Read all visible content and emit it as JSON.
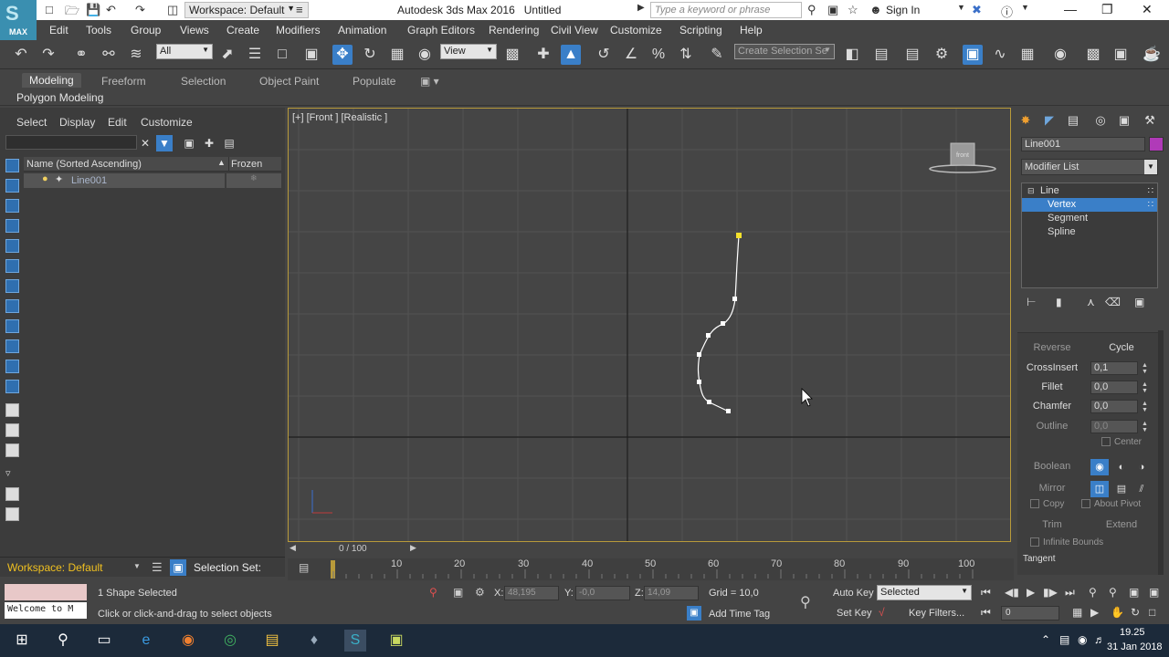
{
  "titlebar": {
    "app_logo": "MAX",
    "workspace": "Workspace: Default",
    "app_title": "Autodesk 3ds Max 2016",
    "file_title": "Untitled",
    "search_placeholder": "Type a keyword or phrase",
    "sign_in": "Sign In"
  },
  "menus": [
    "Edit",
    "Tools",
    "Group",
    "Views",
    "Create",
    "Modifiers",
    "Animation",
    "Graph Editors",
    "Rendering",
    "Civil View",
    "Customize",
    "Scripting",
    "Help"
  ],
  "toolbar": {
    "selection_filter": "All",
    "ref_coord": "View",
    "named_selection": "Create Selection Se"
  },
  "ribbon": {
    "tabs": [
      "Modeling",
      "Freeform",
      "Selection",
      "Object Paint",
      "Populate"
    ],
    "active_tab": "Modeling",
    "sub_label": "Polygon Modeling"
  },
  "explorer": {
    "menus": [
      "Select",
      "Display",
      "Edit",
      "Customize"
    ],
    "col_name": "Name (Sorted Ascending)",
    "col_frozen": "Frozen",
    "rows": [
      {
        "name": "Line001"
      }
    ]
  },
  "viewport": {
    "label": "[+] [Front ] [Realistic ]",
    "viewcube_face": "front"
  },
  "command_panel": {
    "object_name": "Line001",
    "object_color": "#b03ab8",
    "modifier_list": "Modifier List",
    "stack": [
      "Line",
      "Vertex",
      "Segment",
      "Spline"
    ],
    "selected_sub": "Vertex",
    "rollout": {
      "reverse": "Reverse",
      "cycle": "Cycle",
      "cross_insert": "CrossInsert",
      "cross_insert_val": "0,1",
      "fillet": "Fillet",
      "fillet_val": "0,0",
      "chamfer": "Chamfer",
      "chamfer_val": "0,0",
      "outline": "Outline",
      "outline_val": "0,0",
      "center": "Center",
      "boolean": "Boolean",
      "mirror": "Mirror",
      "copy": "Copy",
      "about_pivot": "About Pivot",
      "trim": "Trim",
      "extend": "Extend",
      "infinite_bounds": "Infinite Bounds",
      "tangent": "Tangent"
    }
  },
  "bottom": {
    "workspace": "Workspace: Default",
    "selection_set": "Selection Set:",
    "time_slider": "0 / 100",
    "ticks": [
      "10",
      "20",
      "30",
      "40",
      "50",
      "60",
      "70",
      "80",
      "90",
      "100"
    ],
    "listener": "Welcome to M",
    "status_selected": "1 Shape Selected",
    "status_prompt": "Click or click-and-drag to select objects",
    "x_label": "X:",
    "x_val": "48,195",
    "y_label": "Y:",
    "y_val": "-0,0",
    "z_label": "Z:",
    "z_val": "14,09",
    "grid": "Grid = 10,0",
    "add_time_tag": "Add Time Tag",
    "auto_key": "Auto Key",
    "set_key": "Set Key",
    "key_mode": "Selected",
    "key_filters": "Key Filters...",
    "frame": "0"
  },
  "taskbar": {
    "time": "19.25",
    "date": "31 Jan 2018"
  }
}
